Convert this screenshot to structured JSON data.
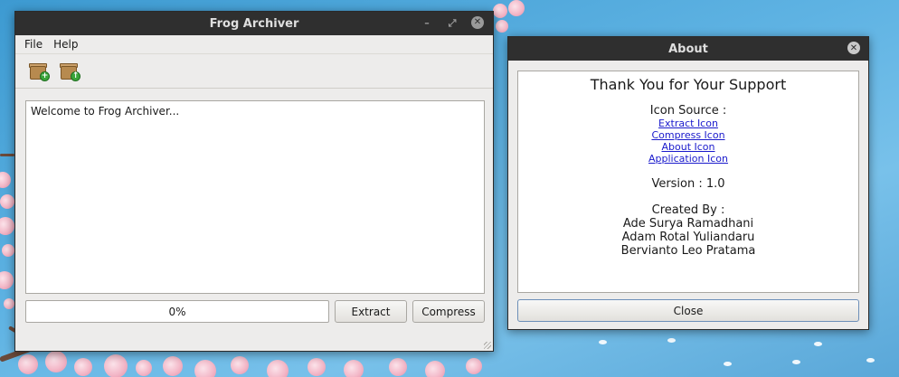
{
  "main_window": {
    "title": "Frog Archiver",
    "controls": {
      "minimize": "–",
      "maximize": "⤢",
      "close": "✕"
    },
    "menu": [
      "File",
      "Help"
    ],
    "toolbar": {
      "extract_icon": "extract-archive-icon",
      "compress_icon": "compress-archive-icon"
    },
    "log_text": "Welcome to Frog Archiver...",
    "progress": {
      "label": "0%",
      "value": 0
    },
    "buttons": {
      "extract": "Extract",
      "compress": "Compress"
    }
  },
  "about_window": {
    "title": "About",
    "close_glyph": "✕",
    "heading": "Thank You for Your Support",
    "icon_source_label": "Icon Source :",
    "links": [
      "Extract Icon",
      "Compress Icon",
      "About Icon",
      "Application Icon"
    ],
    "version": "Version : 1.0",
    "created_by_label": "Created By :",
    "authors": [
      "Ade Surya Ramadhani",
      "Adam Rotal Yuliandaru",
      "Bervianto Leo Pratama"
    ],
    "close_button": "Close"
  },
  "colors": {
    "titlebar": "#2f2f2f",
    "window_bg": "#edeceb",
    "link": "#1a1acc",
    "desktop": "#5fb3e3"
  }
}
